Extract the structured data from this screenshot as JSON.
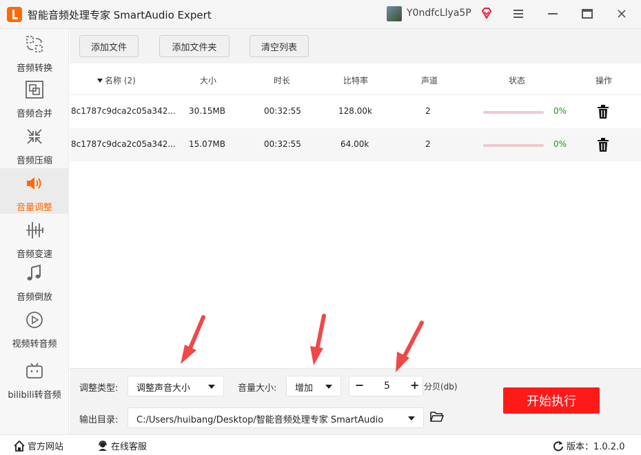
{
  "window": {
    "title": "智能音频处理专家 SmartAudio Expert",
    "username": "Y0ndfcLlya5P",
    "accent_color": "#ff6a00"
  },
  "sidebar": {
    "items": [
      {
        "label": "音频转换",
        "icon": "audio-convert-icon"
      },
      {
        "label": "音频合并",
        "icon": "audio-merge-icon"
      },
      {
        "label": "音频压缩",
        "icon": "audio-compress-icon"
      },
      {
        "label": "音量调整",
        "icon": "volume-icon",
        "active": true
      },
      {
        "label": "音频变速",
        "icon": "audio-speed-icon"
      },
      {
        "label": "音频倒放",
        "icon": "music-note-icon"
      },
      {
        "label": "视频转音频",
        "icon": "video-play-icon"
      },
      {
        "label": "bilibili转音频",
        "icon": "bilibili-icon"
      }
    ]
  },
  "toolbar": {
    "add_file": "添加文件",
    "add_folder": "添加文件夹",
    "clear_list": "清空列表"
  },
  "table": {
    "headers": {
      "name": "名称 (2)",
      "size": "大小",
      "duration": "时长",
      "bitrate": "比特率",
      "channels": "声道",
      "status": "状态",
      "actions": "操作"
    },
    "rows": [
      {
        "name": "8c1787c9dca2c05a342...",
        "size": "30.15MB",
        "duration": "00:32:55",
        "bitrate": "128.00k",
        "channels": "2",
        "progress": "0%"
      },
      {
        "name": "8c1787c9dca2c05a342...",
        "size": "15.07MB",
        "duration": "00:32:55",
        "bitrate": "64.00k",
        "channels": "2",
        "progress": "0%"
      }
    ]
  },
  "controls": {
    "adjust_type_label": "调整类型:",
    "adjust_type_value": "调整声音大小",
    "volume_label": "音量大小:",
    "volume_mode_value": "增加",
    "volume_amount": "5",
    "unit_label": "分贝(db)",
    "output_label": "输出目录:",
    "output_path": "C:/Users/huibang/Desktop/智能音频处理专家 SmartAudio",
    "start_button": "开始执行"
  },
  "statusbar": {
    "website": "官方网站",
    "support": "在线客服",
    "version": "版本：1.0.2.0"
  }
}
